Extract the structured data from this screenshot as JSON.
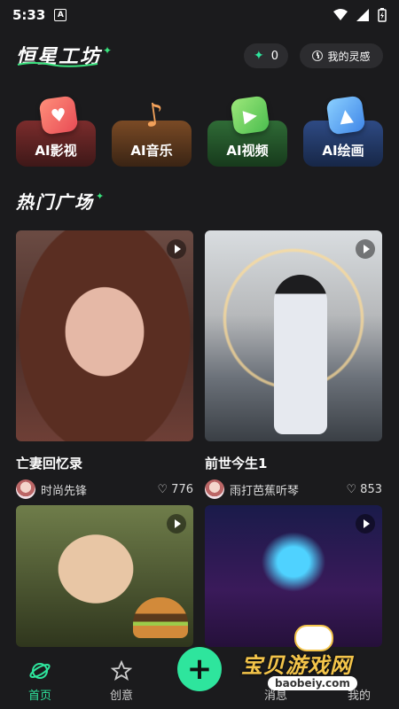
{
  "status": {
    "time": "5:33",
    "badge": "A"
  },
  "header": {
    "brand": "恒星工坊",
    "gem_count": "0",
    "inspiration_label": "我的灵感"
  },
  "categories": [
    {
      "label": "AI影视",
      "icon": "heart-icon"
    },
    {
      "label": "AI音乐",
      "icon": "music-note-icon"
    },
    {
      "label": "AI视频",
      "icon": "tv-play-icon"
    },
    {
      "label": "AI绘画",
      "icon": "picture-icon"
    }
  ],
  "section_title": "热门广场",
  "feed": [
    {
      "title": "亡妻回忆录",
      "author": "时尚先锋",
      "likes": "776"
    },
    {
      "title": "前世今生1",
      "author": "雨打芭蕉听琴",
      "likes": "853"
    },
    {
      "title": "",
      "author": "",
      "likes": ""
    },
    {
      "title": "",
      "author": "",
      "likes": ""
    }
  ],
  "nav": {
    "home": "首页",
    "create": "创意",
    "messages": "消息",
    "mine": "我的"
  },
  "watermark": {
    "text": "宝贝游戏网",
    "url": "baobeiy.com"
  },
  "colors": {
    "accent": "#2ee59d",
    "background": "#1b1b1d"
  }
}
